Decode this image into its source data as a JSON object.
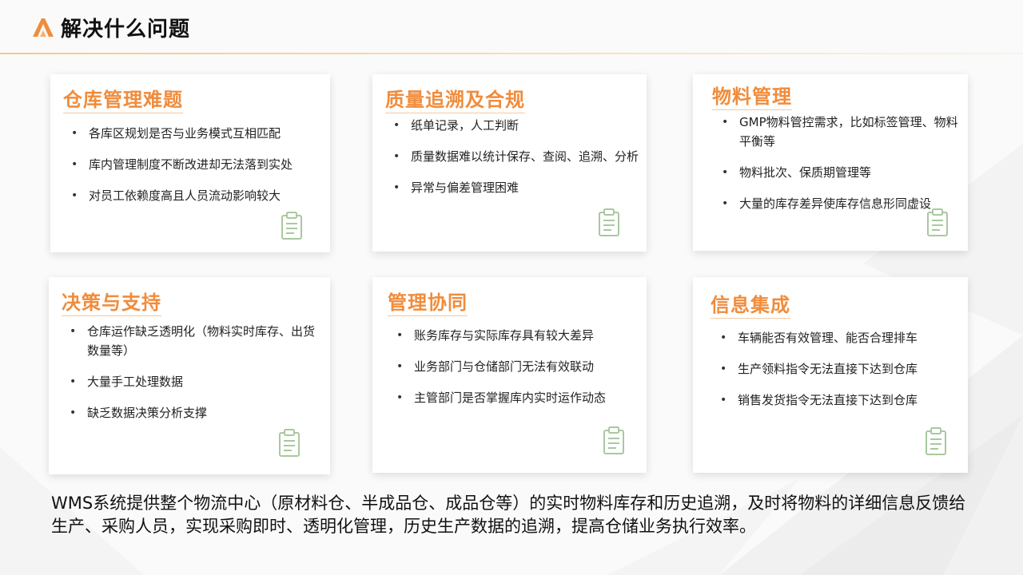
{
  "header": {
    "title": "解决什么问题"
  },
  "cards": [
    {
      "title": "仓库管理难题",
      "items": [
        "各库区规划是否与业务模式互相匹配",
        "库内管理制度不断改进却无法落到实处",
        "对员工依赖度高且人员流动影响较大"
      ]
    },
    {
      "title": "质量追溯及合规",
      "items": [
        "纸单记录，人工判断",
        "质量数据难以统计保存、查阅、追溯、分析",
        "异常与偏差管理困难"
      ]
    },
    {
      "title": "物料管理",
      "items": [
        "GMP物料管控需求，比如标签管理、物料平衡等",
        "物料批次、保质期管理等",
        "大量的库存差异使库存信息形同虚设"
      ]
    },
    {
      "title": "决策与支持",
      "items": [
        "仓库运作缺乏透明化（物料实时库存、出货数量等）",
        "大量手工处理数据",
        "缺乏数据决策分析支撑"
      ]
    },
    {
      "title": "管理协同",
      "items": [
        "账务库存与实际库存具有较大差异",
        "业务部门与仓储部门无法有效联动",
        "主管部门是否掌握库内实时运作动态"
      ]
    },
    {
      "title": "信息集成",
      "items": [
        "车辆能否有效管理、能否合理排车",
        "生产领料指令无法直接下达到仓库",
        "销售发货指令无法直接下达到仓库"
      ]
    }
  ],
  "summary": "WMS系统提供整个物流中心（原材料仓、半成品仓、成品仓等）的实时物料库存和历史追溯，及时将物料的详细信息反馈给生产、采购人员，实现采购即时、透明化管理，历史生产数据的追溯，提高仓储业务执行效率。",
  "colors": {
    "accent": "#f08c3c",
    "icon": "#a9c8a0"
  },
  "icons": {
    "logo": "logo-icon",
    "card": "clipboard-icon"
  }
}
